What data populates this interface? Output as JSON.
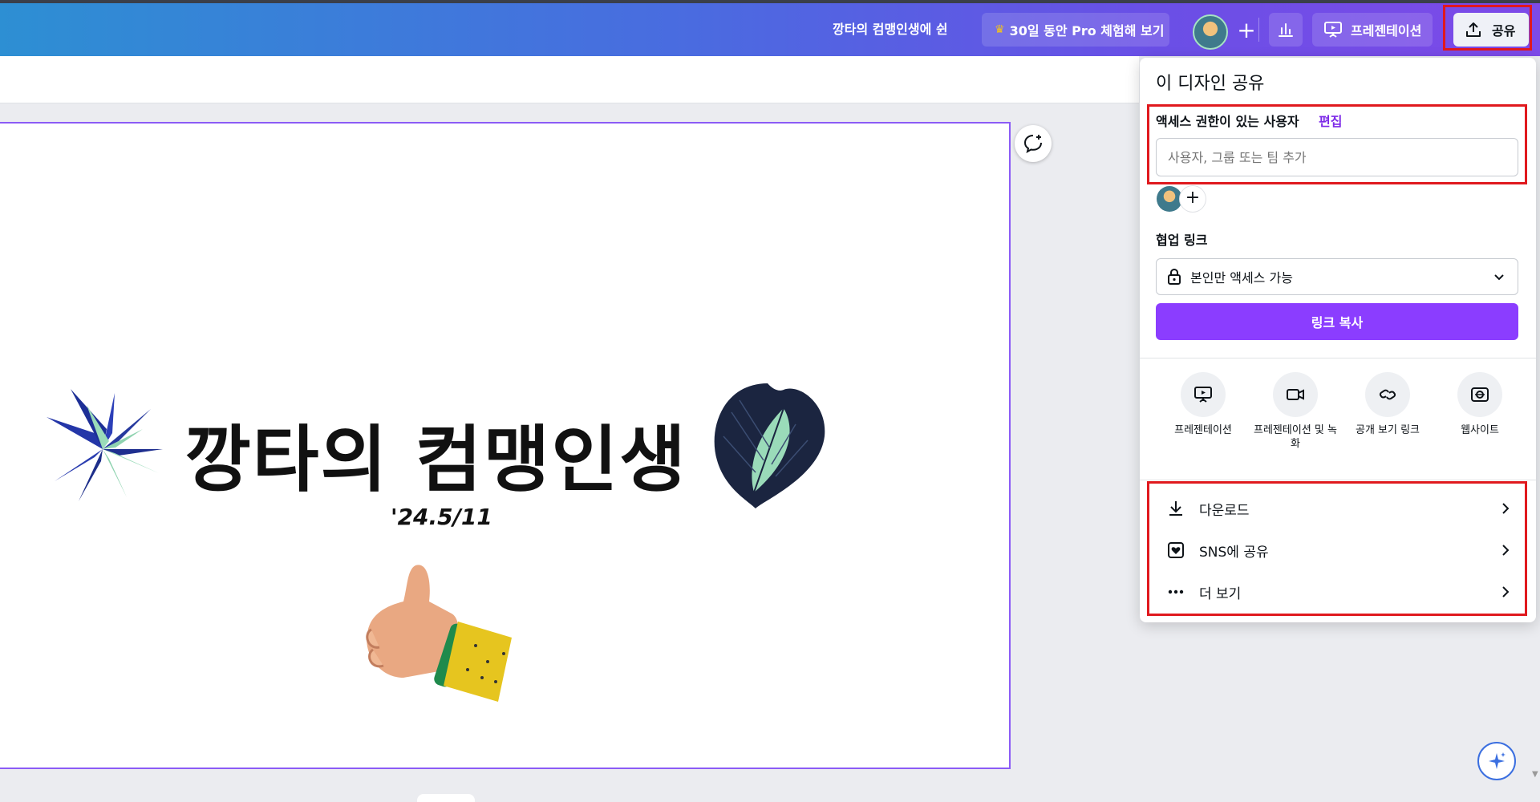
{
  "header": {
    "doc_title": "깡타의 컴맹인생에 쉰",
    "pro_trial_label": "30일 동안 Pro 체험해 보기",
    "present_label": "프레젠테이션",
    "share_label": "공유"
  },
  "slide": {
    "title": "깡타의 컴맹인생",
    "date": "'24.5/11"
  },
  "share_panel": {
    "title": "이 디자인 공유",
    "access_label": "액세스 권한이 있는 사용자",
    "edit_link": "편집",
    "add_placeholder": "사용자, 그룹 또는 팀 추가",
    "collab_label": "협업 링크",
    "access_option": "본인만 액세스 가능",
    "copy_link": "링크 복사",
    "options": [
      {
        "label": "프레젠테이션",
        "icon": "present-icon"
      },
      {
        "label": "프레젠테이션 및 녹화",
        "icon": "record-icon"
      },
      {
        "label": "공개 보기 링크",
        "icon": "link-icon"
      },
      {
        "label": "웹사이트",
        "icon": "website-icon"
      }
    ],
    "rows": [
      {
        "label": "다운로드",
        "icon": "download-icon"
      },
      {
        "label": "SNS에 공유",
        "icon": "heart-icon"
      },
      {
        "label": "더 보기",
        "icon": "more-icon"
      }
    ]
  },
  "colors": {
    "accent_purple": "#8b3dff",
    "highlight_red": "#e0191e",
    "page_border": "#8b5cf6"
  }
}
